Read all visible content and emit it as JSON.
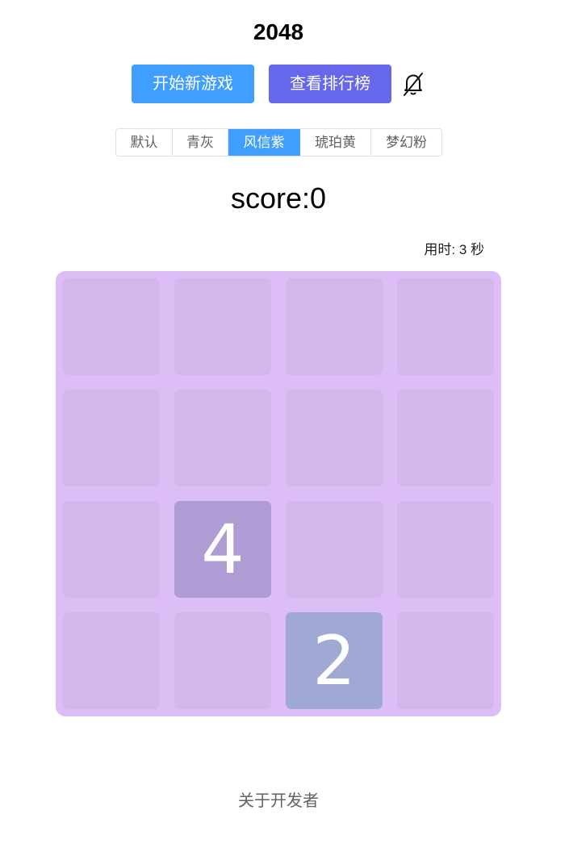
{
  "title": "2048",
  "buttons": {
    "new_game": "开始新游戏",
    "leaderboard": "查看排行榜"
  },
  "icons": {
    "sound": "bell-off-icon"
  },
  "themes": {
    "items": [
      "默认",
      "青灰",
      "风信紫",
      "琥珀黄",
      "梦幻粉"
    ],
    "selected": "风信紫"
  },
  "score_text": "score:0",
  "timer_text": "用时: 3 秒",
  "board": {
    "size": 4,
    "tiles": [
      [
        null,
        null,
        null,
        null
      ],
      [
        null,
        null,
        null,
        null
      ],
      [
        null,
        "4",
        null,
        null
      ],
      [
        null,
        null,
        "2",
        null
      ]
    ]
  },
  "footer": {
    "about": "关于开发者"
  },
  "colors": {
    "board_bg": "#ddbdf5",
    "empty_cell": "#d2b8ea",
    "tile_2": "#a0a8d4",
    "tile_4": "#af9cd4",
    "primary": "#409eff",
    "leaderboard_btn": "#6667eb"
  }
}
